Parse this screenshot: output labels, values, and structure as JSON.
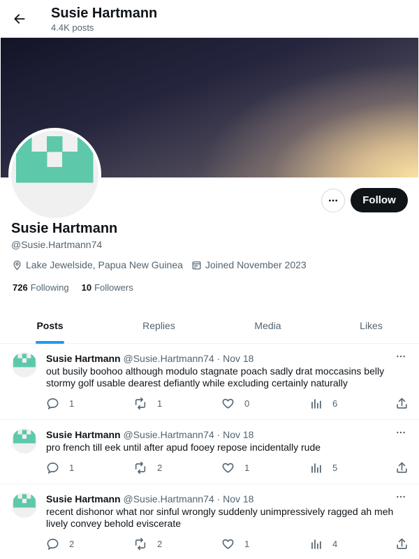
{
  "header": {
    "title": "Susie Hartmann",
    "post_count": "4.4K posts"
  },
  "profile": {
    "name": "Susie Hartmann",
    "handle": "@Susie.Hartmann74",
    "location": "Lake Jewelside, Papua New Guinea",
    "joined": "Joined November 2023",
    "following_count": "726",
    "following_label": "Following",
    "followers_count": "10",
    "followers_label": "Followers",
    "follow_label": "Follow",
    "avatar_color": "#5ec8aa"
  },
  "tabs": [
    {
      "label": "Posts",
      "active": true
    },
    {
      "label": "Replies",
      "active": false
    },
    {
      "label": "Media",
      "active": false
    },
    {
      "label": "Likes",
      "active": false
    }
  ],
  "posts": [
    {
      "name": "Susie Hartmann",
      "handle": "@Susie.Hartmann74",
      "date": "Nov 18",
      "text": "out busily boohoo although modulo stagnate poach sadly drat moccasins belly stormy golf usable dearest defiantly while excluding certainly naturally",
      "replies": "1",
      "reposts": "1",
      "likes": "0",
      "views": "6"
    },
    {
      "name": "Susie Hartmann",
      "handle": "@Susie.Hartmann74",
      "date": "Nov 18",
      "text": "pro french till eek until after apud fooey repose incidentally rude",
      "replies": "1",
      "reposts": "2",
      "likes": "1",
      "views": "5"
    },
    {
      "name": "Susie Hartmann",
      "handle": "@Susie.Hartmann74",
      "date": "Nov 18",
      "text": "recent dishonor what nor sinful wrongly suddenly unimpressively ragged ah meh lively convey behold eviscerate",
      "replies": "2",
      "reposts": "2",
      "likes": "1",
      "views": "4"
    }
  ],
  "icons": {
    "back": "arrow-left-icon",
    "more": "more-horizontal-icon",
    "location": "location-pin-icon",
    "calendar": "calendar-icon",
    "reply": "reply-icon",
    "repost": "repost-icon",
    "like": "heart-icon",
    "views": "views-icon",
    "share": "share-icon"
  },
  "colors": {
    "accent": "#1d9bf0",
    "text": "#0f1419",
    "muted": "#536471"
  }
}
